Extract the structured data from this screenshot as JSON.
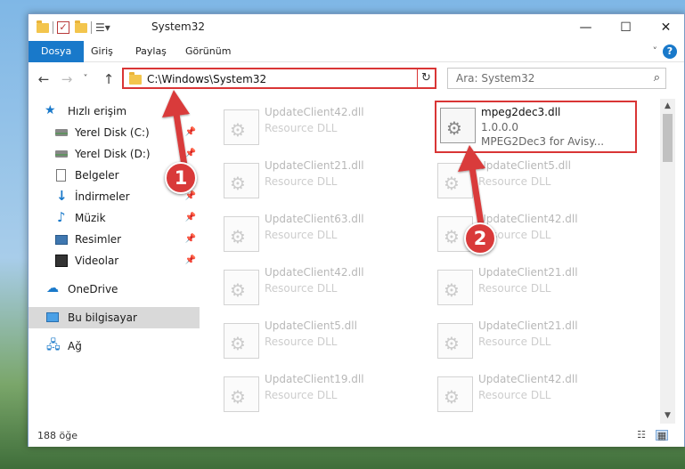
{
  "window": {
    "title": "System32",
    "minimize": "—",
    "maximize": "☐",
    "close": "✕"
  },
  "ribbon": {
    "tabs": [
      "Dosya",
      "Giriş",
      "Paylaş",
      "Görünüm"
    ],
    "expand": "˅",
    "help": "?"
  },
  "nav": {
    "back": "←",
    "forward": "→",
    "recent": "˅",
    "up": "↑",
    "address": "C:\\Windows\\System32",
    "address_dropdown": "˅",
    "refresh": "↻",
    "search_placeholder": "Ara: System32",
    "search_icon": "search-icon"
  },
  "sidebar": {
    "items": [
      {
        "label": "Hızlı erişim",
        "icon": "star-icon",
        "pinned": false
      },
      {
        "label": "Yerel Disk (C:)",
        "icon": "disk-icon",
        "pinned": true
      },
      {
        "label": "Yerel Disk (D:)",
        "icon": "disk-icon",
        "pinned": true
      },
      {
        "label": "Belgeler",
        "icon": "document-icon",
        "pinned": true
      },
      {
        "label": "İndirmeler",
        "icon": "download-icon",
        "pinned": true
      },
      {
        "label": "Müzik",
        "icon": "music-icon",
        "pinned": true
      },
      {
        "label": "Resimler",
        "icon": "pictures-icon",
        "pinned": true
      },
      {
        "label": "Videolar",
        "icon": "videos-icon",
        "pinned": true
      },
      {
        "label": "OneDrive",
        "icon": "cloud-icon",
        "pinned": false
      },
      {
        "label": "Bu bilgisayar",
        "icon": "computer-icon",
        "pinned": false,
        "selected": true
      },
      {
        "label": "Ağ",
        "icon": "network-icon",
        "pinned": false
      }
    ],
    "pin_glyph": "📌"
  },
  "files": {
    "left": [
      {
        "name": "UpdateClient42.dll",
        "type": "Resource DLL"
      },
      {
        "name": "UpdateClient21.dll",
        "type": "Resource DLL"
      },
      {
        "name": "UpdateClient63.dll",
        "type": "Resource DLL"
      },
      {
        "name": "UpdateClient42.dll",
        "type": "Resource DLL"
      },
      {
        "name": "UpdateClient5.dll",
        "type": "Resource DLL"
      },
      {
        "name": "UpdateClient19.dll",
        "type": "Resource DLL"
      }
    ],
    "right": [
      {
        "name": "mpeg2dec3.dll",
        "version": "1.0.0.0",
        "type": "MPEG2Dec3 for Avisy...",
        "highlighted": true
      },
      {
        "name": "UpdateClient5.dll",
        "type": "Resource DLL"
      },
      {
        "name": "UpdateClient42.dll",
        "type": "Resource DLL"
      },
      {
        "name": "UpdateClient21.dll",
        "type": "Resource DLL"
      },
      {
        "name": "UpdateClient21.dll",
        "type": "Resource DLL"
      },
      {
        "name": "UpdateClient42.dll",
        "type": "Resource DLL"
      }
    ]
  },
  "status": {
    "count": "188 öğe"
  },
  "callouts": [
    "1",
    "2"
  ],
  "colors": {
    "accent": "#1979ca",
    "highlight_red": "#d93535",
    "selected_bg": "#d9d9d9"
  }
}
